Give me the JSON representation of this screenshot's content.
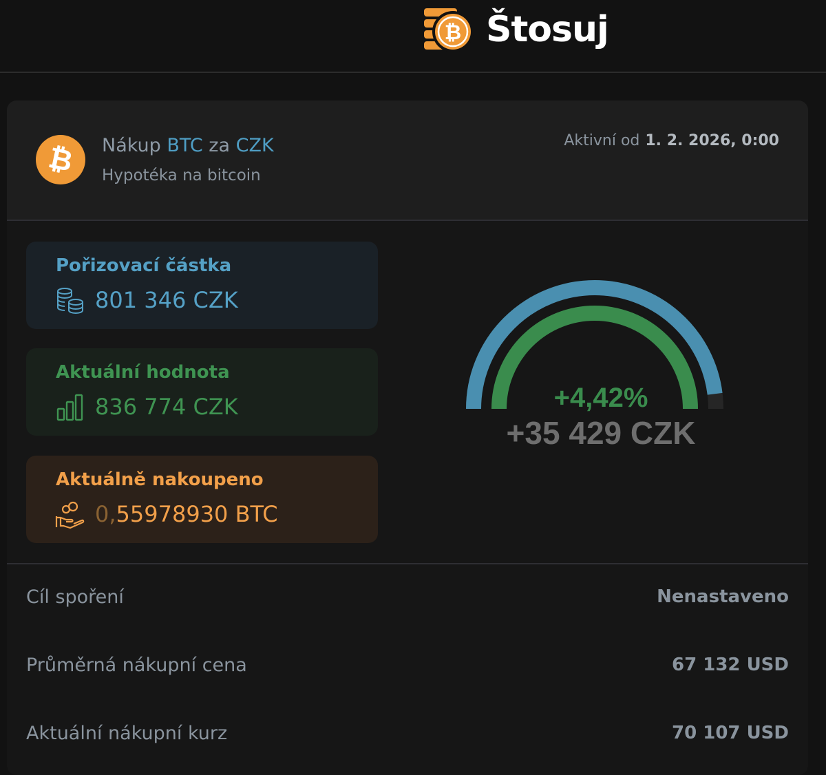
{
  "header": {
    "brand": "Štosuj",
    "brand_icon": "bitcoin-coin-stack-logo"
  },
  "plan": {
    "icon": "bitcoin-icon",
    "title_prefix": "Nákup",
    "asset": "BTC",
    "title_mid": "za",
    "currency": "CZK",
    "subtitle": "Hypotéka na bitcoin",
    "active_label": "Aktivní od",
    "active_date": "1. 2. 2026, 0:00"
  },
  "stats": {
    "cost": {
      "label": "Pořizovací částka",
      "value": "801 346 CZK",
      "icon": "coins-icon"
    },
    "current": {
      "label": "Aktuální hodnota",
      "value": "836 774 CZK",
      "icon": "bar-chart-icon"
    },
    "bought": {
      "label": "Aktuálně nakoupeno",
      "value_dim": "0,",
      "value": "55978930 BTC",
      "icon": "hand-coins-icon"
    }
  },
  "gauge": {
    "percent": "+4,42%",
    "absolute": "+35 429 CZK",
    "outer_fill_fraction": 0.96,
    "inner_fill_fraction": 1.0,
    "colors": {
      "outer": "#4a8fb0",
      "inner": "#3a8c4d",
      "track": "#262626"
    }
  },
  "details": [
    {
      "key": "Cíl spoření",
      "value": "Nenastaveno"
    },
    {
      "key": "Průměrná nákupní cena",
      "value": "67 132 USD"
    },
    {
      "key": "Aktuální nákupní kurz",
      "value": "70 107 USD"
    }
  ]
}
